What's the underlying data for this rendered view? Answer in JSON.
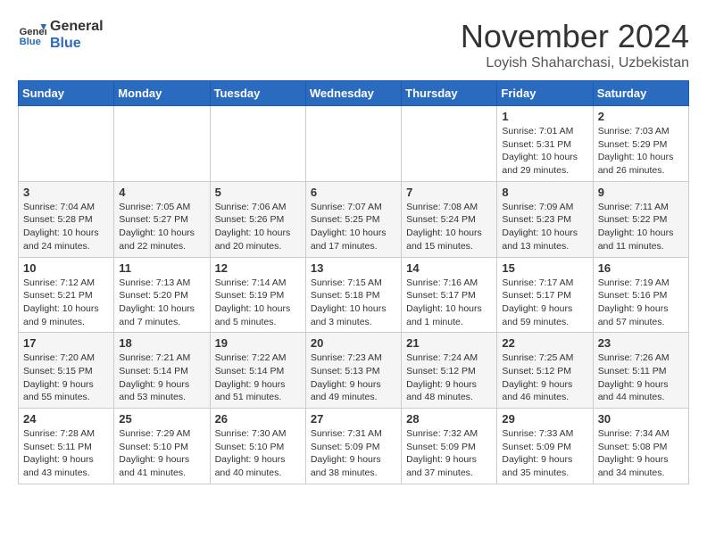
{
  "logo": {
    "line1": "General",
    "line2": "Blue"
  },
  "title": "November 2024",
  "location": "Loyish Shaharchasi, Uzbekistan",
  "days_of_week": [
    "Sunday",
    "Monday",
    "Tuesday",
    "Wednesday",
    "Thursday",
    "Friday",
    "Saturday"
  ],
  "weeks": [
    [
      {
        "day": "",
        "info": ""
      },
      {
        "day": "",
        "info": ""
      },
      {
        "day": "",
        "info": ""
      },
      {
        "day": "",
        "info": ""
      },
      {
        "day": "",
        "info": ""
      },
      {
        "day": "1",
        "info": "Sunrise: 7:01 AM\nSunset: 5:31 PM\nDaylight: 10 hours and 29 minutes."
      },
      {
        "day": "2",
        "info": "Sunrise: 7:03 AM\nSunset: 5:29 PM\nDaylight: 10 hours and 26 minutes."
      }
    ],
    [
      {
        "day": "3",
        "info": "Sunrise: 7:04 AM\nSunset: 5:28 PM\nDaylight: 10 hours and 24 minutes."
      },
      {
        "day": "4",
        "info": "Sunrise: 7:05 AM\nSunset: 5:27 PM\nDaylight: 10 hours and 22 minutes."
      },
      {
        "day": "5",
        "info": "Sunrise: 7:06 AM\nSunset: 5:26 PM\nDaylight: 10 hours and 20 minutes."
      },
      {
        "day": "6",
        "info": "Sunrise: 7:07 AM\nSunset: 5:25 PM\nDaylight: 10 hours and 17 minutes."
      },
      {
        "day": "7",
        "info": "Sunrise: 7:08 AM\nSunset: 5:24 PM\nDaylight: 10 hours and 15 minutes."
      },
      {
        "day": "8",
        "info": "Sunrise: 7:09 AM\nSunset: 5:23 PM\nDaylight: 10 hours and 13 minutes."
      },
      {
        "day": "9",
        "info": "Sunrise: 7:11 AM\nSunset: 5:22 PM\nDaylight: 10 hours and 11 minutes."
      }
    ],
    [
      {
        "day": "10",
        "info": "Sunrise: 7:12 AM\nSunset: 5:21 PM\nDaylight: 10 hours and 9 minutes."
      },
      {
        "day": "11",
        "info": "Sunrise: 7:13 AM\nSunset: 5:20 PM\nDaylight: 10 hours and 7 minutes."
      },
      {
        "day": "12",
        "info": "Sunrise: 7:14 AM\nSunset: 5:19 PM\nDaylight: 10 hours and 5 minutes."
      },
      {
        "day": "13",
        "info": "Sunrise: 7:15 AM\nSunset: 5:18 PM\nDaylight: 10 hours and 3 minutes."
      },
      {
        "day": "14",
        "info": "Sunrise: 7:16 AM\nSunset: 5:17 PM\nDaylight: 10 hours and 1 minute."
      },
      {
        "day": "15",
        "info": "Sunrise: 7:17 AM\nSunset: 5:17 PM\nDaylight: 9 hours and 59 minutes."
      },
      {
        "day": "16",
        "info": "Sunrise: 7:19 AM\nSunset: 5:16 PM\nDaylight: 9 hours and 57 minutes."
      }
    ],
    [
      {
        "day": "17",
        "info": "Sunrise: 7:20 AM\nSunset: 5:15 PM\nDaylight: 9 hours and 55 minutes."
      },
      {
        "day": "18",
        "info": "Sunrise: 7:21 AM\nSunset: 5:14 PM\nDaylight: 9 hours and 53 minutes."
      },
      {
        "day": "19",
        "info": "Sunrise: 7:22 AM\nSunset: 5:14 PM\nDaylight: 9 hours and 51 minutes."
      },
      {
        "day": "20",
        "info": "Sunrise: 7:23 AM\nSunset: 5:13 PM\nDaylight: 9 hours and 49 minutes."
      },
      {
        "day": "21",
        "info": "Sunrise: 7:24 AM\nSunset: 5:12 PM\nDaylight: 9 hours and 48 minutes."
      },
      {
        "day": "22",
        "info": "Sunrise: 7:25 AM\nSunset: 5:12 PM\nDaylight: 9 hours and 46 minutes."
      },
      {
        "day": "23",
        "info": "Sunrise: 7:26 AM\nSunset: 5:11 PM\nDaylight: 9 hours and 44 minutes."
      }
    ],
    [
      {
        "day": "24",
        "info": "Sunrise: 7:28 AM\nSunset: 5:11 PM\nDaylight: 9 hours and 43 minutes."
      },
      {
        "day": "25",
        "info": "Sunrise: 7:29 AM\nSunset: 5:10 PM\nDaylight: 9 hours and 41 minutes."
      },
      {
        "day": "26",
        "info": "Sunrise: 7:30 AM\nSunset: 5:10 PM\nDaylight: 9 hours and 40 minutes."
      },
      {
        "day": "27",
        "info": "Sunrise: 7:31 AM\nSunset: 5:09 PM\nDaylight: 9 hours and 38 minutes."
      },
      {
        "day": "28",
        "info": "Sunrise: 7:32 AM\nSunset: 5:09 PM\nDaylight: 9 hours and 37 minutes."
      },
      {
        "day": "29",
        "info": "Sunrise: 7:33 AM\nSunset: 5:09 PM\nDaylight: 9 hours and 35 minutes."
      },
      {
        "day": "30",
        "info": "Sunrise: 7:34 AM\nSunset: 5:08 PM\nDaylight: 9 hours and 34 minutes."
      }
    ]
  ]
}
